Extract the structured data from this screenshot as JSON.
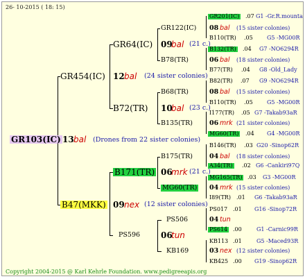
{
  "header": {
    "date": "26- 10-2015 ( 18: 15)"
  },
  "footer": {
    "copyright": "Copyright 2004-2015 @ Karl Kehrle Foundation.   www.pedigreeapis.org"
  },
  "root": {
    "name": "GR103(IC)",
    "num": "13",
    "word": "bal",
    "note": "(Drones from 22 sister colonies)"
  },
  "gen1": [
    {
      "name": "GR454(IC)",
      "num": "12",
      "word": "bal",
      "note": "(24 sister colonies)"
    },
    {
      "name": "B47(MKK)",
      "num": "09",
      "word": "nex",
      "note": "(12 sister colonies)"
    }
  ],
  "gen2": [
    {
      "name": "GR64(IC)",
      "num": "09",
      "word": "bal",
      "note": "(21 c.)"
    },
    {
      "name": "B72(TR)",
      "num": "10",
      "word": "bal",
      "note": "(23 c.)"
    },
    {
      "name": "B171(TR)",
      "num": "06",
      "word": "mrk",
      "note": "(21 c.)"
    },
    {
      "name": "PS596",
      "num": "06",
      "word": "tun",
      "note": ""
    }
  ],
  "gen3": [
    {
      "name": "GR122(IC)",
      "num": "08",
      "word": "bal",
      "note": "(15 sister colonies)"
    },
    {
      "name": "B78(TR)",
      "num": "06",
      "word": "bal",
      "note": "(18 sister colonies)"
    },
    {
      "name": "B68(TR)",
      "num": "08",
      "word": "bal",
      "note": "(15 sister colonies)"
    },
    {
      "name": "B135(TR)",
      "num": "06",
      "word": "mrk",
      "note": "(21 sister colonies)"
    },
    {
      "name": "B175(TR)",
      "num": "04",
      "word": "bal",
      "note": "(18 sister colonies)"
    },
    {
      "name": "MG60(TR)",
      "num": "04",
      "word": "mrk",
      "note": "(15 sister colonies)"
    },
    {
      "name": "PS506",
      "num": "04",
      "word": "tun",
      "note": ""
    },
    {
      "name": "KB169",
      "num": "03",
      "word": "nex",
      "note": "(12 sister colonies)"
    }
  ],
  "gen4": [
    {
      "name": "GR201(IC)",
      "num": ".07",
      "tag": "G1 -Gr.R.mounta"
    },
    {
      "name": "B110(TR)",
      "num": ".05",
      "tag": "G5 -MG00R"
    },
    {
      "name": "B132(TR)",
      "num": ".04",
      "tag": "G7 -NO6294R"
    },
    {
      "name": "B77(TR)",
      "num": ".04",
      "tag": "G8 -Old_Lady"
    },
    {
      "name": "B82(TR)",
      "num": ".07",
      "tag": "G9 -NO6294R"
    },
    {
      "name": "B110(TR)",
      "num": ".05",
      "tag": "G5 -MG00R"
    },
    {
      "name": "I177(TR)",
      "num": ".05",
      "tag": "G7 -Takab93aR"
    },
    {
      "name": "MG60(TR)",
      "num": ".04",
      "tag": "G4 -MG00R"
    },
    {
      "name": "B146(TR)",
      "num": ".03",
      "tag": "G20 -Sinop62R"
    },
    {
      "name": "A34(TR)",
      "num": ".02",
      "tag": "G6 -Cankiri97Q"
    },
    {
      "name": "MG165(TR)",
      "num": ".03",
      "tag": "G3 -MG00R"
    },
    {
      "name": "I89(TR)",
      "num": ".01",
      "tag": "G6 -Takab93aR"
    },
    {
      "name": "PS017",
      "num": ".01",
      "tag": "G16 -Sinop72R"
    },
    {
      "name": "PS614",
      "num": ".00",
      "tag": "G1 -Carnic99R"
    },
    {
      "name": "KB113",
      "num": ".01",
      "tag": "G5 -Maced93R"
    },
    {
      "name": "KB425",
      "num": ".00",
      "tag": "G19 -Sinop62R"
    }
  ],
  "colors": {
    "background": "#ffffe0",
    "highlight_green": "#22d040",
    "highlight_yellow": "#ffff40",
    "highlight_lilac": "#e6c8f0",
    "blue_text": "#1a1aa8",
    "red_text": "#cc0000"
  }
}
